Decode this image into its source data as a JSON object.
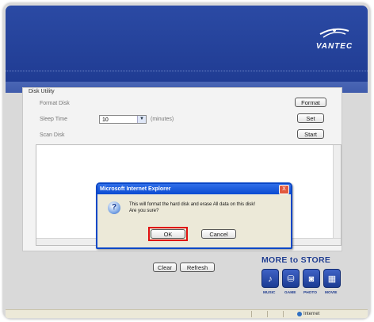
{
  "brand": {
    "name": "VANTEC"
  },
  "panel": {
    "title": "Disk Utility",
    "format_label": "Format Disk",
    "sleep_label": "Sleep Time",
    "sleep_value": "10",
    "sleep_unit": "(minutes)",
    "scan_label": "Scan Disk",
    "format_button": "Format",
    "set_button": "Set",
    "start_button": "Start",
    "clear_button": "Clear",
    "refresh_button": "Refresh"
  },
  "dialog": {
    "title": "Microsoft Internet Explorer",
    "message_line1": "This will format the hard disk and erase All data on this disk!",
    "message_line2": "Are you sure?",
    "ok_label": "OK",
    "cancel_label": "Cancel",
    "close_label": "X"
  },
  "promo": {
    "title": "MORE to STORE",
    "labels": [
      "MUSIC",
      "GAME",
      "PHOTO",
      "MOVIE"
    ],
    "icons": [
      "music-icon",
      "database-icon",
      "camera-icon",
      "movie-icon"
    ]
  },
  "status": {
    "zone": "Internet"
  }
}
